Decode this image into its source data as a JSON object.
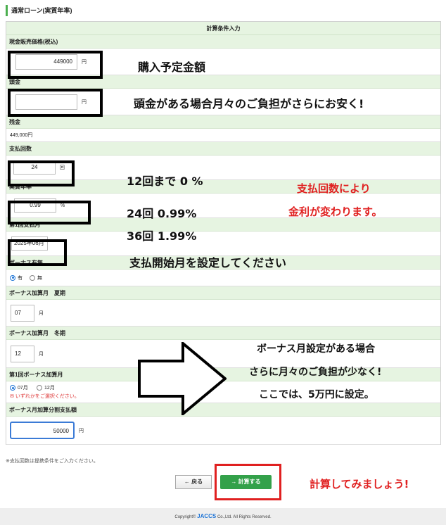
{
  "page_title": "通常ローン(実質年率)",
  "form": {
    "header": "計算条件入力",
    "cash_price": {
      "label": "現金販売価格(税込)",
      "value": "449000",
      "unit": "円"
    },
    "down_payment": {
      "label": "頭金",
      "value": "",
      "unit": "円"
    },
    "balance": {
      "label": "残金",
      "value": "449,000円"
    },
    "installments": {
      "label": "支払回数",
      "value": "24",
      "unit": "回"
    },
    "apr": {
      "label": "実質年率",
      "value": "0.99",
      "unit": "%"
    },
    "first_month": {
      "label": "第1回支払月",
      "value": "2025年06月"
    },
    "bonus": {
      "label": "ボーナス有無",
      "options": [
        "有",
        "無"
      ],
      "selected": "有"
    },
    "bonus_summer": {
      "label": "ボーナス加算月　夏期",
      "value": "07",
      "unit": "月"
    },
    "bonus_winter": {
      "label": "ボーナス加算月　冬期",
      "value": "12",
      "unit": "月"
    },
    "first_bonus": {
      "label": "第1回ボーナス加算月",
      "options": [
        "07月",
        "12月"
      ],
      "selected": "07月",
      "warning": "いずれかをご選択ください。"
    },
    "bonus_amount": {
      "label": "ボーナス月加算分割支払額",
      "value": "50000",
      "unit": "円"
    }
  },
  "note": "※支払回数は提携条件をご入力ください。",
  "buttons": {
    "back": "← 戻る",
    "calc": "→ 計算する"
  },
  "footer": {
    "copyright": "Copyright©",
    "brand": "JACCS",
    "rights": "Co.,Ltd. All Rights Reserved."
  },
  "annotations": {
    "purchase": "購入予定金額",
    "downpay": "頭金がある場合月々のご負担がさらにお安く!",
    "rate1": "12回まで  0 %",
    "rate2": "24回 0.99%",
    "rate3": "36回 1.99%",
    "rate_note1": "支払回数により",
    "rate_note2": "金利が変わります。",
    "start_month": "支払開始月を設定してください",
    "bonus1": "ボーナス月設定がある場合",
    "bonus2": "さらに月々のご負担が少なく!",
    "bonus3": "ここでは、5万円に設定。",
    "calc_hint": "計算してみましょう!"
  }
}
